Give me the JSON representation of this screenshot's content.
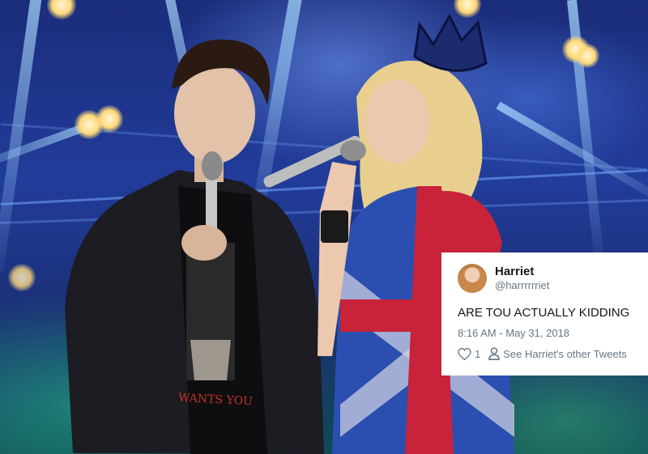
{
  "tweet": {
    "display_name": "Harriet",
    "handle": "@harrrrrriet",
    "text": "ARE TOU ACTUALLY KIDDING",
    "timestamp": "8:16 AM - May 31, 2018",
    "like_count": "1",
    "other_tweets_label": "See Harriet's other Tweets",
    "icons": [
      "heart-icon",
      "person-icon"
    ]
  },
  "photo": {
    "shirt_text": "WANTS YOU",
    "colors": {
      "stage_blue": "#213c9a",
      "stage_green": "#0f4a55",
      "tweet_gray": "#657786"
    }
  }
}
